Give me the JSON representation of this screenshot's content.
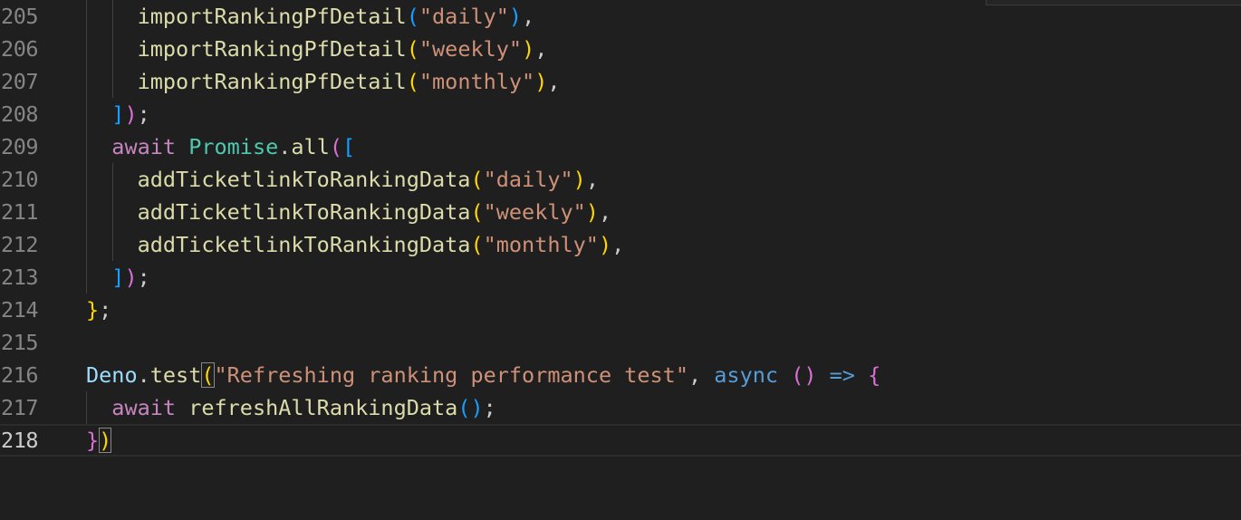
{
  "editor": {
    "lines": [
      {
        "number": "205",
        "tokens": [
          {
            "t": "    ",
            "c": "punc"
          },
          {
            "t": "importRankingPfDetail",
            "c": "fn"
          },
          {
            "t": "(",
            "c": "b3"
          },
          {
            "t": "\"daily\"",
            "c": "str"
          },
          {
            "t": ")",
            "c": "b3"
          },
          {
            "t": ",",
            "c": "punc"
          }
        ]
      },
      {
        "number": "206",
        "tokens": [
          {
            "t": "    ",
            "c": "punc"
          },
          {
            "t": "importRankingPfDetail",
            "c": "fn"
          },
          {
            "t": "(",
            "c": "b1"
          },
          {
            "t": "\"weekly\"",
            "c": "str"
          },
          {
            "t": ")",
            "c": "b1"
          },
          {
            "t": ",",
            "c": "punc"
          }
        ]
      },
      {
        "number": "207",
        "tokens": [
          {
            "t": "    ",
            "c": "punc"
          },
          {
            "t": "importRankingPfDetail",
            "c": "fn"
          },
          {
            "t": "(",
            "c": "b1"
          },
          {
            "t": "\"monthly\"",
            "c": "str"
          },
          {
            "t": ")",
            "c": "b1"
          },
          {
            "t": ",",
            "c": "punc"
          }
        ]
      },
      {
        "number": "208",
        "tokens": [
          {
            "t": "  ",
            "c": "punc"
          },
          {
            "t": "]",
            "c": "b3"
          },
          {
            "t": ")",
            "c": "b2"
          },
          {
            "t": ";",
            "c": "punc"
          }
        ]
      },
      {
        "number": "209",
        "tokens": [
          {
            "t": "  ",
            "c": "punc"
          },
          {
            "t": "await",
            "c": "kw"
          },
          {
            "t": " ",
            "c": "punc"
          },
          {
            "t": "Promise",
            "c": "cls"
          },
          {
            "t": ".",
            "c": "punc"
          },
          {
            "t": "all",
            "c": "fn"
          },
          {
            "t": "(",
            "c": "b2"
          },
          {
            "t": "[",
            "c": "b3"
          }
        ]
      },
      {
        "number": "210",
        "tokens": [
          {
            "t": "    ",
            "c": "punc"
          },
          {
            "t": "addTicketlinkToRankingData",
            "c": "fn"
          },
          {
            "t": "(",
            "c": "b1"
          },
          {
            "t": "\"daily\"",
            "c": "str"
          },
          {
            "t": ")",
            "c": "b1"
          },
          {
            "t": ",",
            "c": "punc"
          }
        ]
      },
      {
        "number": "211",
        "tokens": [
          {
            "t": "    ",
            "c": "punc"
          },
          {
            "t": "addTicketlinkToRankingData",
            "c": "fn"
          },
          {
            "t": "(",
            "c": "b1"
          },
          {
            "t": "\"weekly\"",
            "c": "str"
          },
          {
            "t": ")",
            "c": "b1"
          },
          {
            "t": ",",
            "c": "punc"
          }
        ]
      },
      {
        "number": "212",
        "tokens": [
          {
            "t": "    ",
            "c": "punc"
          },
          {
            "t": "addTicketlinkToRankingData",
            "c": "fn"
          },
          {
            "t": "(",
            "c": "b1"
          },
          {
            "t": "\"monthly\"",
            "c": "str"
          },
          {
            "t": ")",
            "c": "b1"
          },
          {
            "t": ",",
            "c": "punc"
          }
        ]
      },
      {
        "number": "213",
        "tokens": [
          {
            "t": "  ",
            "c": "punc"
          },
          {
            "t": "]",
            "c": "b3"
          },
          {
            "t": ")",
            "c": "b2"
          },
          {
            "t": ";",
            "c": "punc"
          }
        ]
      },
      {
        "number": "214",
        "tokens": [
          {
            "t": "}",
            "c": "b1"
          },
          {
            "t": ";",
            "c": "punc"
          }
        ]
      },
      {
        "number": "215",
        "tokens": []
      },
      {
        "number": "216",
        "tokens": [
          {
            "t": "Deno",
            "c": "var"
          },
          {
            "t": ".",
            "c": "punc"
          },
          {
            "t": "test",
            "c": "fn"
          },
          {
            "t": "(",
            "c": "b1",
            "m": true
          },
          {
            "t": "\"Refreshing ranking performance test\"",
            "c": "str"
          },
          {
            "t": ", ",
            "c": "punc"
          },
          {
            "t": "async",
            "c": "kwb"
          },
          {
            "t": " ",
            "c": "punc"
          },
          {
            "t": "()",
            "c": "b2"
          },
          {
            "t": " ",
            "c": "punc"
          },
          {
            "t": "=>",
            "c": "kwb"
          },
          {
            "t": " ",
            "c": "punc"
          },
          {
            "t": "{",
            "c": "b2"
          }
        ]
      },
      {
        "number": "217",
        "tokens": [
          {
            "t": "  ",
            "c": "punc"
          },
          {
            "t": "await",
            "c": "kw"
          },
          {
            "t": " ",
            "c": "punc"
          },
          {
            "t": "refreshAllRankingData",
            "c": "fn"
          },
          {
            "t": "()",
            "c": "b3"
          },
          {
            "t": ";",
            "c": "punc"
          }
        ]
      },
      {
        "number": "218",
        "current": true,
        "tokens": [
          {
            "t": "}",
            "c": "b2"
          },
          {
            "t": ")",
            "c": "b1",
            "m": true
          }
        ]
      }
    ],
    "colors": {
      "background": "#1f1f1f",
      "function": "#dcdcaa",
      "string": "#ce9178",
      "keyword": "#c586c0",
      "storage": "#569cd6",
      "class": "#4ec9b0",
      "variable": "#9cdcfe",
      "bracket_gold": "#ffd700",
      "bracket_orchid": "#da70d6",
      "bracket_blue": "#179fff"
    }
  }
}
